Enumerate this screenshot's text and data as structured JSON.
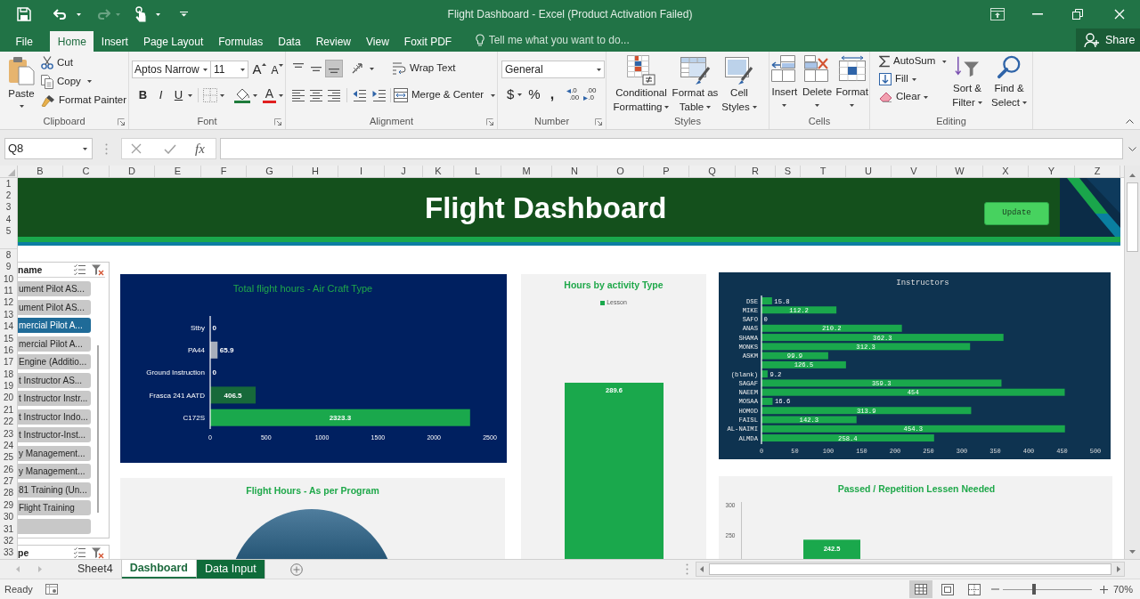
{
  "title_bar": {
    "title": "Flight Dashboard - Excel (Product Activation Failed)"
  },
  "menu_tabs": [
    {
      "label": "File",
      "selected": false
    },
    {
      "label": "Home",
      "selected": true
    },
    {
      "label": "Insert",
      "selected": false
    },
    {
      "label": "Page Layout",
      "selected": false
    },
    {
      "label": "Formulas",
      "selected": false
    },
    {
      "label": "Data",
      "selected": false
    },
    {
      "label": "Review",
      "selected": false
    },
    {
      "label": "View",
      "selected": false
    },
    {
      "label": "Foxit PDF",
      "selected": false
    }
  ],
  "tell_me": {
    "placeholder": "Tell me what you want to do..."
  },
  "share_button": {
    "label": "Share"
  },
  "ribbon": {
    "clipboard": {
      "paste": "Paste",
      "cut": "Cut",
      "copy": "Copy",
      "format_painter": "Format Painter",
      "label": "Clipboard"
    },
    "font": {
      "font_name": "Aptos Narrow",
      "font_size": "11",
      "grow_font": "A",
      "shrink_font": "A",
      "bold": "B",
      "italic": "I",
      "underline": "U",
      "font_color": "A",
      "label": "Font"
    },
    "alignment": {
      "vertical_align": [
        {
          "kind": "top",
          "selected": false
        },
        {
          "kind": "middle",
          "selected": false
        },
        {
          "kind": "bottom",
          "selected": true
        }
      ],
      "wrap_text": "Wrap Text",
      "merge_center": "Merge & Center",
      "label": "Alignment"
    },
    "number": {
      "format": "General",
      "currency": "$",
      "percent": "%",
      "comma": ",",
      "increase_decimal": [
        ".0",
        ".00"
      ],
      "decrease_decimal": [
        ".00",
        ".0"
      ],
      "label": "Number"
    },
    "styles": {
      "conditional_formatting": "Conditional Formatting",
      "format_as_table": "Format as Table",
      "cell_styles": "Cell Styles",
      "label": "Styles"
    },
    "cells": {
      "insert": "Insert",
      "delete": "Delete",
      "format": "Format",
      "label": "Cells"
    },
    "editing": {
      "autosum": "AutoSum",
      "fill": "Fill",
      "clear": "Clear",
      "sort_filter": "Sort & Filter",
      "find_select": "Find & Select",
      "label": "Editing"
    }
  },
  "formula_bar": {
    "name_box": "Q8",
    "function_label": "fx"
  },
  "column_headers": [
    "B",
    "C",
    "D",
    "E",
    "F",
    "G",
    "H",
    "I",
    "J",
    "K",
    "L",
    "M",
    "N",
    "O",
    "P",
    "Q",
    "R",
    "S",
    "T",
    "U",
    "V",
    "W",
    "X",
    "Y",
    "Z"
  ],
  "row_headers": [
    "1",
    "2",
    "3",
    "4",
    "5",
    "8",
    "9",
    "10",
    "11",
    "12",
    "13",
    "14",
    "15",
    "16",
    "17",
    "18",
    "19",
    "20",
    "21",
    "22",
    "23",
    "24",
    "25",
    "26",
    "27",
    "28",
    "29",
    "30",
    "31",
    "32",
    "33"
  ],
  "dashboard": {
    "title": "Flight Dashboard",
    "update_button": "Update"
  },
  "slicers": [
    {
      "header": "name",
      "items": [
        {
          "label": "ument Pilot AS...",
          "selected": false
        },
        {
          "label": "ument Pilot AS...",
          "selected": false
        },
        {
          "label": "mercial Pilot A...",
          "selected": true
        },
        {
          "label": "mercial Pilot A...",
          "selected": false
        },
        {
          "label": "Engine (Additio...",
          "selected": false
        },
        {
          "label": "t Instructor AS...",
          "selected": false
        },
        {
          "label": "t Instructor Instr...",
          "selected": false
        },
        {
          "label": "t Instructor Indo...",
          "selected": false
        },
        {
          "label": "t Instructor-Inst...",
          "selected": false
        },
        {
          "label": "y Management...",
          "selected": false
        },
        {
          "label": "y Management...",
          "selected": false
        },
        {
          "label": "81 Training (Un...",
          "selected": false
        },
        {
          "label": "Flight Training",
          "selected": false
        },
        {
          "selected": false
        }
      ]
    },
    {
      "header": "pe"
    }
  ],
  "aircraft_chart": {
    "chart_data": {
      "type": "bar",
      "orientation": "horizontal",
      "title": "Total flight hours - Air Craft Type",
      "categories": [
        "Stby",
        "PA44",
        "Ground Instruction",
        "Frasca 241 AATD",
        "C172S"
      ],
      "series": [
        {
          "color": "#1aa84c",
          "colors": [
            null,
            "#a7aebb",
            null,
            "#17693a",
            null
          ],
          "values": [
            0,
            65.9,
            0,
            406.5,
            2323.3
          ]
        }
      ],
      "xlim": [
        0,
        2500
      ],
      "xticks": [
        0,
        500,
        1000,
        1500,
        2000,
        2500
      ],
      "data_labels": true
    }
  },
  "activity_chart": {
    "title": "Hours by activity Type",
    "legend": [
      "Lesson"
    ],
    "bar_label": "289.6"
  },
  "instructors_chart": {
    "chart_data": {
      "type": "bar",
      "orientation": "horizontal",
      "title": "Instructors",
      "categories": [
        "DSE",
        "MIKE",
        "SAFO",
        "ANAS",
        "SHAMA",
        "MONKS",
        "ASKM",
        null,
        "(blank)",
        "SAGAF",
        "NAEEM",
        "MOSAA",
        "HOMOD",
        "FAISL",
        "AL-NAIMI",
        "ALMDA"
      ],
      "series": [
        {
          "color": "#1aa84c",
          "values": [
            15.8,
            112.2,
            0,
            210.2,
            362.3,
            312.3,
            99.9,
            126.5,
            9.2,
            359.3,
            454,
            16.6,
            313.9,
            142.3,
            454.3,
            258.4
          ]
        }
      ],
      "xlim": [
        0,
        500
      ],
      "xticks": [
        0,
        50,
        100,
        150,
        200,
        250,
        300,
        350,
        400,
        450,
        500
      ],
      "data_labels": true
    }
  },
  "program_chart": {
    "title": "Flight Hours - As per Program"
  },
  "passed_chart": {
    "chart_data": {
      "type": "bar",
      "title": "Passed / Repetition Lessen Needed",
      "categories": [
        null
      ],
      "series": [
        {
          "color": "#1aa84c",
          "values": [
            242.5
          ]
        }
      ],
      "ylim": [
        210,
        305
      ],
      "yticks": [
        250,
        300
      ],
      "data_labels": true
    }
  },
  "sheet_tabs": [
    {
      "label": "Sheet4",
      "selected": false
    },
    {
      "label": "Dashboard",
      "selected": true
    },
    {
      "label": "Data Input",
      "selected": false,
      "color": "#0f6b3a"
    }
  ],
  "status_bar": {
    "status": "Ready",
    "views": [
      {
        "kind": "normal",
        "selected": true
      },
      {
        "kind": "page_layout",
        "selected": false
      },
      {
        "kind": "page_break",
        "selected": false
      }
    ],
    "zoom_slider": {
      "level": 0.35
    },
    "zoom": "70%"
  }
}
